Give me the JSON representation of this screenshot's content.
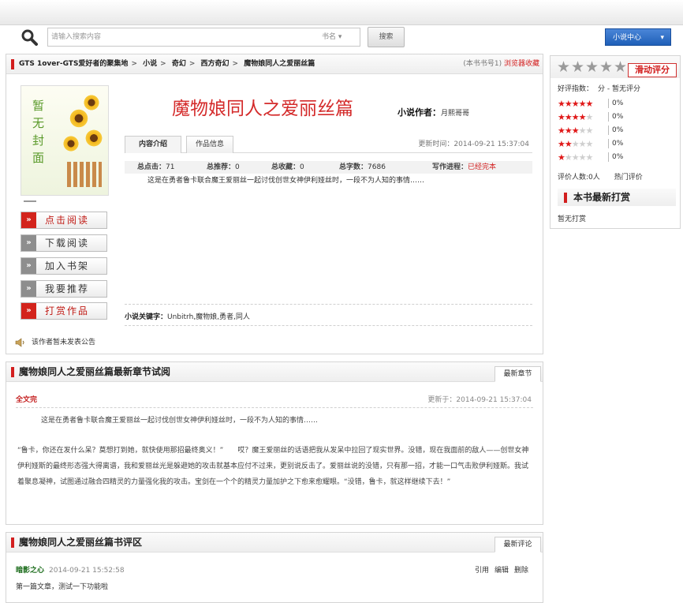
{
  "search": {
    "placeholder": "请输入搜索内容",
    "category": "书名",
    "button": "搜索",
    "user_center": "小说中心"
  },
  "breadcrumb": {
    "items": [
      "GTS 1over-GTS爱好者的聚集地",
      "小说",
      "奇幻",
      "西方奇幻",
      "魔物娘同人之爱丽丝篇"
    ],
    "book_no": "(本书书号1)",
    "favorite": "浏览器收藏"
  },
  "book": {
    "cover_text": "暂无封面",
    "title": "魔物娘同人之爱丽丝篇",
    "author_label": "小说作者：",
    "author": "月熙哥哥",
    "tabs": [
      "内容介绍",
      "作品信息"
    ],
    "update_time": "更新时间：2014-09-21 15:37:04",
    "stats": {
      "total_clicks": {
        "label": "总点击：",
        "value": "71"
      },
      "total_recommend": {
        "label": "总推荐：",
        "value": "0"
      },
      "total_favorite": {
        "label": "总收藏：",
        "value": "0"
      },
      "total_words": {
        "label": "总字数：",
        "value": "7686"
      },
      "progress": {
        "label": "写作进程：",
        "value": "已经完本"
      }
    },
    "intro": "这是在勇者鲁卡联合魔王爱丽丝一起讨伐创世女神伊利娅丝时，一段不为人知的事情……",
    "keywords_label": "小说关键字：",
    "keywords": "Unbitrh,魔物娘,勇者,同人",
    "notice": "该作者暂未发表公告"
  },
  "actions": {
    "read": "点击阅读",
    "download": "下载阅读",
    "shelf": "加入书架",
    "recommend": "我要推荐",
    "reward": "打赏作品"
  },
  "latest": {
    "title": "魔物娘同人之爱丽丝篇最新章节试阅",
    "tab": "最新章节",
    "chapter": "全文完",
    "updated": "更新于：2014-09-21 15:37:04",
    "para1": "这是在勇者鲁卡联合魔王爱丽丝一起讨伐创世女神伊利娅丝时，一段不为人知的事情……",
    "para2": "“鲁卡，你还在发什么呆？莫想打到她，就快使用那招最终奥义！”　　哎？魔王爱丽丝的话语把我从发呆中拉回了现实世界。没错，现在我面前的敌人——创世女神伊利娅斯的最终形态强大得离谱，我和爱丽丝光是躲避她的攻击就基本应付不过来，更别说反击了。爱丽丝说的没错，只有那一招，才能一口气击败伊利娅斯。我试着聚息凝神，试图通过融合四精灵的力量强化我的攻击。宝剑在一个个的精灵力量加护之下愈来愈耀眼。“没错，鲁卡，就这样继续下去！”"
  },
  "reviews": {
    "title": "魔物娘同人之爱丽丝篇书评区",
    "tab": "最新评论",
    "user": "暗影之心",
    "time": "2014-09-21 15:52:58",
    "actions": [
      "引用",
      "编辑",
      "删除"
    ],
    "body": "第一篇文章，测试一下功能啦"
  },
  "rating": {
    "button": "滑动评分",
    "index_label": "好评指数：",
    "index_value": "分 - 暂无评分",
    "rows": [
      {
        "stars": 5,
        "percent": "0%"
      },
      {
        "stars": 4,
        "percent": "0%"
      },
      {
        "stars": 3,
        "percent": "0%"
      },
      {
        "stars": 2,
        "percent": "0%"
      },
      {
        "stars": 1,
        "percent": "0%"
      }
    ],
    "count": "评价人数:0人",
    "hot": "热门评价",
    "reward_title": "本书最新打赏",
    "reward_none": "暂无打赏"
  }
}
